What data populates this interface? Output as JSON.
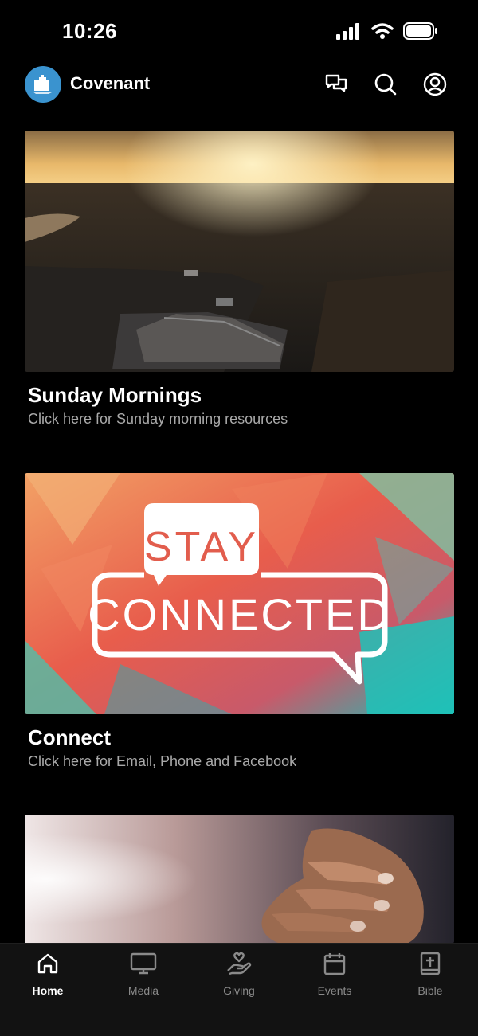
{
  "status_bar": {
    "time": "10:26",
    "icons": [
      "cellular-signal-icon",
      "wifi-icon",
      "battery-icon"
    ]
  },
  "header": {
    "app_title": "Covenant",
    "logo_icon": "church-logo-icon",
    "actions": [
      {
        "name": "chat-icon"
      },
      {
        "name": "search-icon"
      },
      {
        "name": "profile-icon"
      }
    ]
  },
  "feed": {
    "cards": [
      {
        "title": "Sunday Mornings",
        "subtitle": "Click here for Sunday morning resources",
        "image": "aerial-sunset-church-photo"
      },
      {
        "title": "Connect",
        "subtitle": "Click here for Email, Phone and Facebook",
        "image": "stay-connected-graphic",
        "image_text": {
          "line1": "STAY",
          "line2": "CONNECTED"
        }
      },
      {
        "title": "",
        "subtitle": "",
        "image": "praying-hands-photo"
      }
    ]
  },
  "tab_bar": {
    "tabs": [
      {
        "label": "Home",
        "icon": "home-icon",
        "active": true
      },
      {
        "label": "Media",
        "icon": "monitor-icon",
        "active": false
      },
      {
        "label": "Giving",
        "icon": "giving-hand-heart-icon",
        "active": false
      },
      {
        "label": "Events",
        "icon": "calendar-icon",
        "active": false
      },
      {
        "label": "Bible",
        "icon": "bible-icon",
        "active": false
      }
    ]
  },
  "colors": {
    "background": "#000000",
    "tab_bar": "#121212",
    "logo": "#3a93cf",
    "subtitle": "#a9a9a9",
    "inactive_tab": "#8a8a8a"
  }
}
